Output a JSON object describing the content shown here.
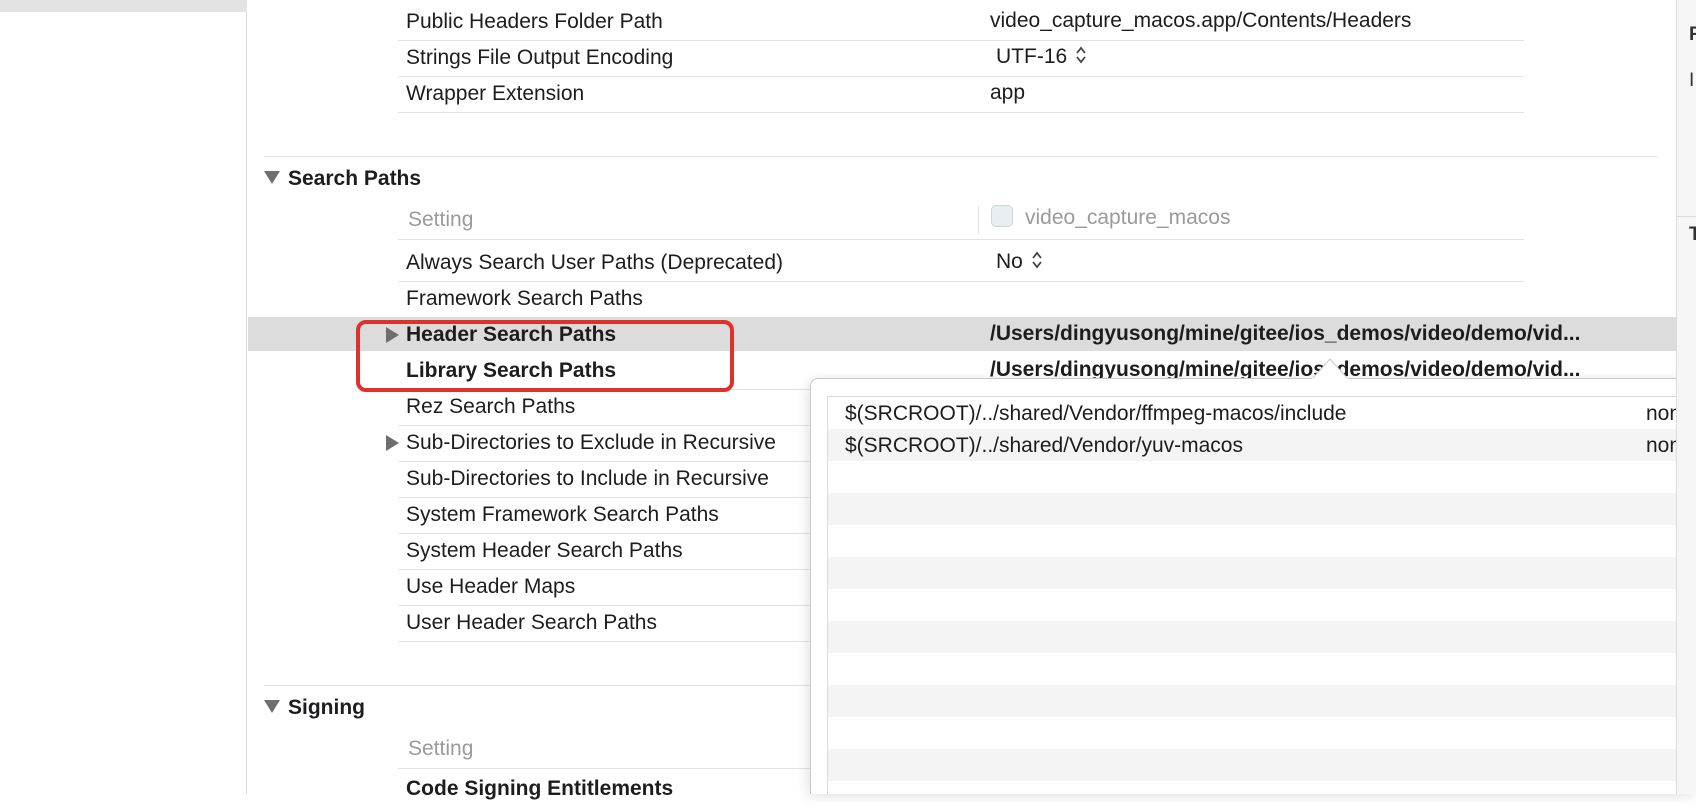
{
  "window": {
    "title": ""
  },
  "top_rows": [
    {
      "name": "Public Headers Folder Path",
      "value": "video_capture_macos.app/Contents/Headers",
      "stepper": false
    },
    {
      "name": "Strings File Output Encoding",
      "value": "UTF-16",
      "stepper": true
    },
    {
      "name": "Wrapper Extension",
      "value": "app",
      "stepper": false
    }
  ],
  "search_paths": {
    "title": "Search Paths",
    "header_setting": "Setting",
    "header_target": "video_capture_macos",
    "rows": [
      {
        "name": "Always Search User Paths (Deprecated)",
        "value": "No",
        "bold": false,
        "expandable": false,
        "stepper": true
      },
      {
        "name": "Framework Search Paths",
        "value": "",
        "bold": false,
        "expandable": false,
        "stepper": false
      },
      {
        "name": "Header Search Paths",
        "value": "/Users/dingyusong/mine/gitee/ios_demos/video/demo/vid...",
        "bold": true,
        "expandable": true,
        "stepper": false
      },
      {
        "name": "Library Search Paths",
        "value": "/Users/dingyusong/mine/gitee/ios_demos/video/demo/vid...",
        "bold": true,
        "expandable": false,
        "stepper": false
      },
      {
        "name": "Rez Search Paths",
        "value": "",
        "bold": false,
        "expandable": false,
        "stepper": false
      },
      {
        "name": "Sub-Directories to Exclude in Recursive",
        "value": "",
        "bold": false,
        "expandable": true,
        "stepper": false
      },
      {
        "name": "Sub-Directories to Include in Recursive",
        "value": "",
        "bold": false,
        "expandable": false,
        "stepper": false
      },
      {
        "name": "System Framework Search Paths",
        "value": "",
        "bold": false,
        "expandable": false,
        "stepper": false
      },
      {
        "name": "System Header Search Paths",
        "value": "",
        "bold": false,
        "expandable": false,
        "stepper": false
      },
      {
        "name": "Use Header Maps",
        "value": "",
        "bold": false,
        "expandable": false,
        "stepper": false
      },
      {
        "name": "User Header Search Paths",
        "value": "",
        "bold": false,
        "expandable": false,
        "stepper": false
      }
    ]
  },
  "signing": {
    "title": "Signing",
    "header_setting": "Setting",
    "first_row": "Code Signing Entitlements"
  },
  "popover": {
    "items": [
      {
        "path": "$(SRCROOT)/../shared/Vendor/ffmpeg-macos/include",
        "mode": "non-r"
      },
      {
        "path": "$(SRCROOT)/../shared/Vendor/yuv-macos",
        "mode": "non-r"
      }
    ],
    "empty_rows": 10
  },
  "inspector": {
    "glyphs": [
      "F",
      "I",
      "T"
    ]
  },
  "colors": {
    "highlight": "#e0302a",
    "selection": "#dcdcdc"
  }
}
